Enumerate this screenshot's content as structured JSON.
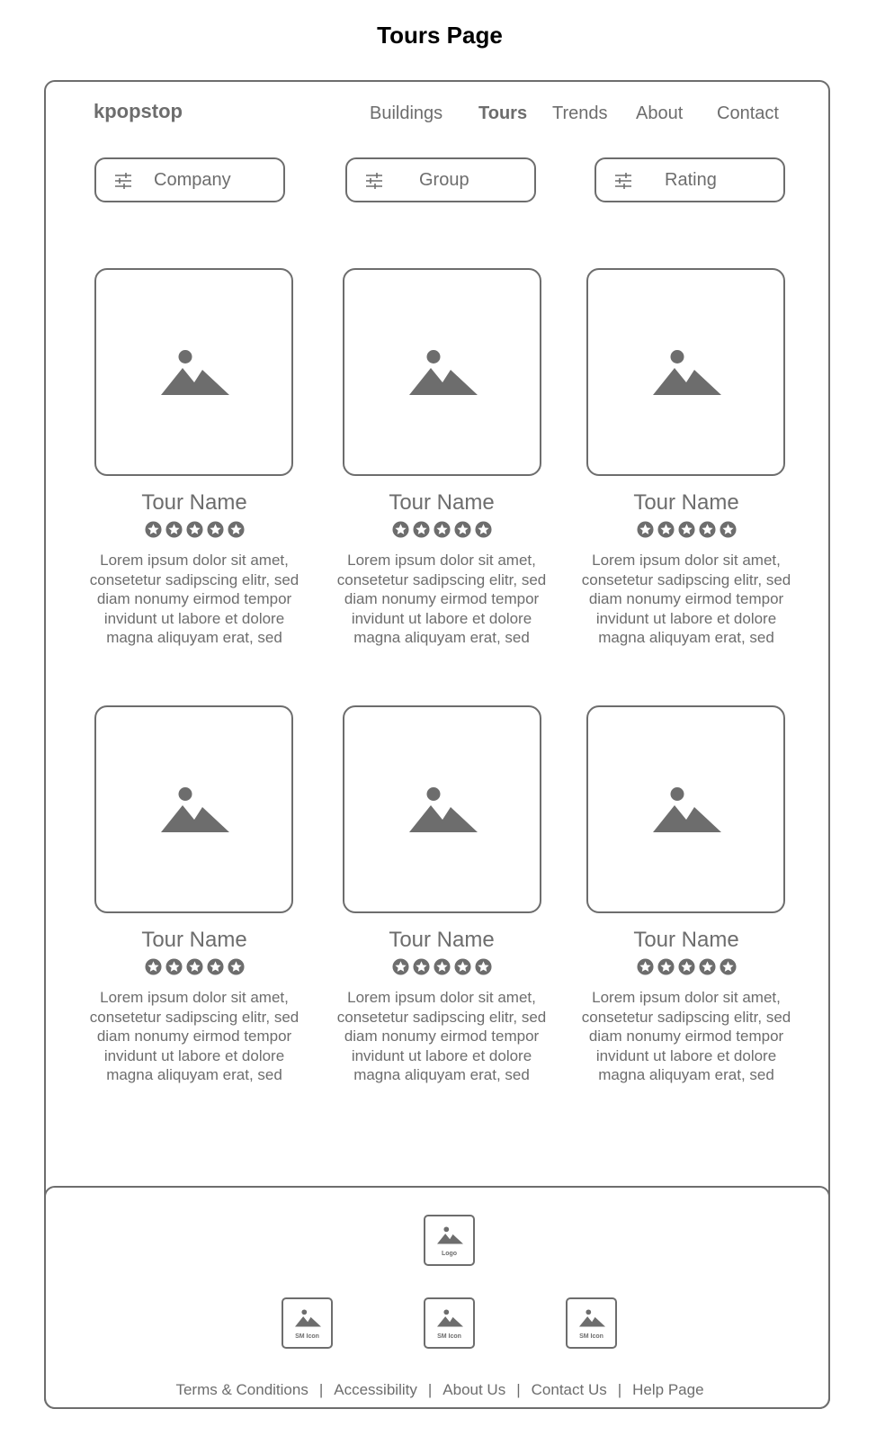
{
  "page": {
    "title": "Tours Page"
  },
  "header": {
    "logo": "kpopstop",
    "nav": [
      {
        "label": "Buildings",
        "active": false
      },
      {
        "label": "Tours",
        "active": true
      },
      {
        "label": "Trends",
        "active": false
      },
      {
        "label": "About",
        "active": false
      },
      {
        "label": "Contact",
        "active": false
      }
    ]
  },
  "filters": [
    {
      "label": "Company",
      "icon": "sliders-icon"
    },
    {
      "label": "Group",
      "icon": "sliders-icon"
    },
    {
      "label": "Rating",
      "icon": "sliders-icon"
    }
  ],
  "tours": [
    {
      "name": "Tour Name",
      "rating_stars": 5,
      "description": "Lorem ipsum dolor sit amet, consetetur sadipscing elitr, sed diam nonumy eirmod tempor invidunt ut labore et dolore magna aliquyam erat, sed"
    },
    {
      "name": "Tour Name",
      "rating_stars": 5,
      "description": "Lorem ipsum dolor sit amet, consetetur sadipscing elitr, sed diam nonumy eirmod tempor invidunt ut labore et dolore magna aliquyam erat, sed"
    },
    {
      "name": "Tour Name",
      "rating_stars": 5,
      "description": "Lorem ipsum dolor sit amet, consetetur sadipscing elitr, sed diam nonumy eirmod tempor invidunt ut labore et dolore magna aliquyam erat, sed"
    },
    {
      "name": "Tour Name",
      "rating_stars": 5,
      "description": "Lorem ipsum dolor sit amet, consetetur sadipscing elitr, sed diam nonumy eirmod tempor invidunt ut labore et dolore magna aliquyam erat, sed"
    },
    {
      "name": "Tour Name",
      "rating_stars": 5,
      "description": "Lorem ipsum dolor sit amet, consetetur sadipscing elitr, sed diam nonumy eirmod tempor invidunt ut labore et dolore magna aliquyam erat, sed"
    },
    {
      "name": "Tour Name",
      "rating_stars": 5,
      "description": "Lorem ipsum dolor sit amet, consetetur sadipscing elitr, sed diam nonumy eirmod tempor invidunt ut labore et dolore magna aliquyam erat, sed"
    }
  ],
  "footer": {
    "logo_label": "Logo",
    "social": [
      {
        "label": "SM Icon"
      },
      {
        "label": "SM Icon"
      },
      {
        "label": "SM Icon"
      }
    ],
    "links": [
      {
        "label": "Terms & Conditions"
      },
      {
        "label": "Accessibility"
      },
      {
        "label": "About Us"
      },
      {
        "label": "Contact Us"
      },
      {
        "label": "Help Page"
      }
    ],
    "separator": "|"
  },
  "colors": {
    "stroke": "#6d6d6d",
    "title": "#000000",
    "background": "#ffffff"
  }
}
